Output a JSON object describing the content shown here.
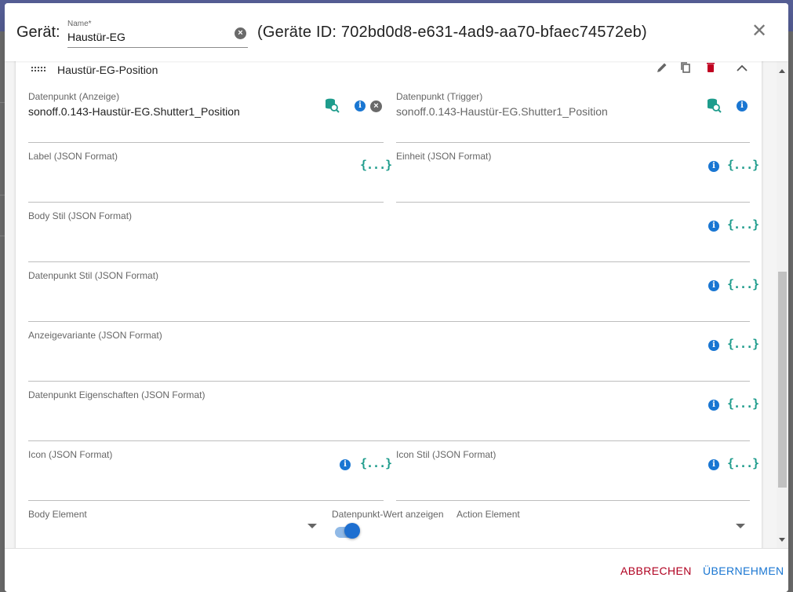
{
  "colors": {
    "primary": "#1976d2",
    "cancel": "#b00020",
    "json_icon": "#1e9c8c",
    "delete": "#c00020"
  },
  "header": {
    "device_label": "Gerät:",
    "name_label": "Name*",
    "name_value": "Haustür-EG",
    "device_id_text": "(Geräte ID: 702bd0d8-e631-4ad9-aa70-bfaec74572eb)"
  },
  "card": {
    "title": "Haustür-EG-Position",
    "fields": {
      "dp_display": {
        "label": "Datenpunkt (Anzeige)",
        "value": "sonoff.0.143-Haustür-EG.Shutter1_Position"
      },
      "dp_trigger": {
        "label": "Datenpunkt (Trigger)",
        "value": "sonoff.0.143-Haustür-EG.Shutter1_Position"
      },
      "label_json": {
        "label": "Label (JSON Format)"
      },
      "unit_json": {
        "label": "Einheit (JSON Format)"
      },
      "body_style": {
        "label": "Body Stil (JSON Format)"
      },
      "dp_style": {
        "label": "Datenpunkt Stil (JSON Format)"
      },
      "display_variant": {
        "label": "Anzeigevariante (JSON Format)"
      },
      "dp_properties": {
        "label": "Datenpunkt Eigenschaften (JSON Format)"
      },
      "icon_json": {
        "label": "Icon (JSON Format)"
      },
      "icon_style": {
        "label": "Icon Stil (JSON Format)"
      },
      "body_element": {
        "label": "Body Element"
      },
      "show_dp_value": {
        "label": "Datenpunkt-Wert anzeigen",
        "checked": true
      },
      "action_element": {
        "label": "Action Element"
      }
    }
  },
  "icons": {
    "json": "{...}",
    "info": "i"
  },
  "footer": {
    "cancel_label": "ABBRECHEN",
    "apply_label": "ÜBERNEHMEN"
  }
}
